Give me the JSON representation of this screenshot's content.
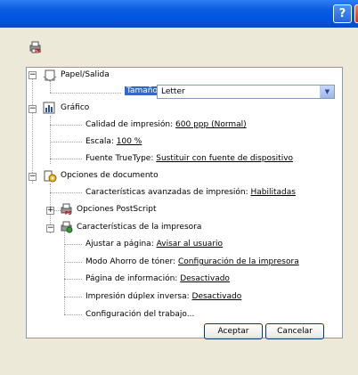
{
  "title_bar": {
    "help_label": "?",
    "close_label": "X"
  },
  "tree": {
    "paper_output": {
      "label": "Papel/Salida",
      "paper_size": {
        "label": "Tamaño del papel:",
        "value": "Letter"
      }
    },
    "graphic": {
      "label": "Gráfico",
      "print_quality": {
        "label": "Calidad de impresión:",
        "value": "600 ppp (Normal)"
      },
      "scaling": {
        "label": "Escala:",
        "value": "100 %"
      },
      "truetype_font": {
        "label": "Fuente TrueType:",
        "value": "Sustituir con fuente de dispositivo"
      }
    },
    "document_options": {
      "label": "Opciones de documento",
      "advanced_features": {
        "label": "Características avanzadas de impresión:",
        "value": "Habilitadas"
      },
      "postscript_options": {
        "label": "Opciones PostScript"
      },
      "printer_features": {
        "label": "Características de la impresora",
        "fit_to_page": {
          "label": "Ajustar a página:",
          "value": "Avisar al usuario"
        },
        "toner_save": {
          "label": "Modo Ahorro de tóner:",
          "value": "Configuración de la impresora"
        },
        "info_page": {
          "label": "Página de información:",
          "value": "Desactivado"
        },
        "reverse_duplex": {
          "label": "Impresión dúplex inversa:",
          "value": "Desactivado"
        },
        "job_settings": {
          "label": "Configuración del trabajo..."
        }
      }
    }
  },
  "buttons": {
    "ok": "Aceptar",
    "cancel": "Cancelar"
  }
}
